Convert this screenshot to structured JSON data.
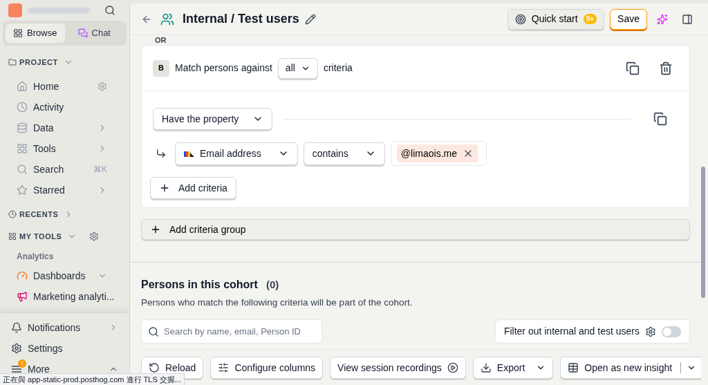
{
  "sidebar": {
    "tabs": [
      {
        "label": "Browse",
        "selected": true
      },
      {
        "label": "Chat",
        "selected": false
      }
    ],
    "sections": [
      {
        "kind": "project",
        "title": "PROJECT",
        "items": [
          {
            "label": "Home",
            "kind": "home",
            "has_settings": true
          },
          {
            "label": "Activity",
            "kind": "activity"
          },
          {
            "label": "Data",
            "kind": "data",
            "has_submenu": true
          },
          {
            "label": "Tools",
            "kind": "tools",
            "has_submenu": true
          },
          {
            "label": "Search",
            "kind": "search",
            "shortcut": "⌘K"
          },
          {
            "label": "Starred",
            "kind": "star",
            "has_submenu": true
          }
        ]
      },
      {
        "kind": "recents",
        "title": "RECENTS"
      },
      {
        "kind": "tools",
        "title": "MY TOOLS",
        "group": "Analytics",
        "items": [
          {
            "label": "Dashboards",
            "kind": "dashboards",
            "expandable": true
          },
          {
            "label": "Marketing analyti...",
            "kind": "marketing"
          }
        ]
      }
    ],
    "footer": [
      {
        "label": "Notifications",
        "kind": "bell",
        "has_submenu": true
      },
      {
        "label": "Settings",
        "kind": "gear"
      },
      {
        "label": "More",
        "kind": "more",
        "badge": "!"
      }
    ]
  },
  "header": {
    "title": "Internal / Test users",
    "quick_start": "Quick start",
    "quick_start_badge": "9+",
    "save": "Save"
  },
  "criteria": {
    "or_label": "OR",
    "group_letter": "B",
    "match_prefix": "Match persons against",
    "match_value": "all",
    "match_suffix": "criteria",
    "filter_type": "Have the property",
    "property": "Email address",
    "operator": "contains",
    "values": [
      "@limaois.me"
    ],
    "add_criteria": "Add criteria"
  },
  "add_group": "Add criteria group",
  "persons": {
    "title": "Persons in this cohort",
    "count": "(0)",
    "description": "Persons who match the following criteria will be part of the cohort.",
    "search": {
      "placeholder": "Search by name, email, Person ID"
    },
    "filter_toggle": {
      "label": "Filter out internal and test users",
      "on": false
    },
    "actions": [
      {
        "label": "Reload",
        "kind": "reload"
      },
      {
        "label": "Configure columns",
        "kind": "columns"
      },
      {
        "label": "View session recordings",
        "kind": "recordings"
      },
      {
        "label": "Export",
        "kind": "export"
      },
      {
        "label": "Open as new insight",
        "kind": "insight"
      }
    ]
  },
  "status_bar": "正在與 app-static-prod.posthog.com 進行 TLS 交握..."
}
